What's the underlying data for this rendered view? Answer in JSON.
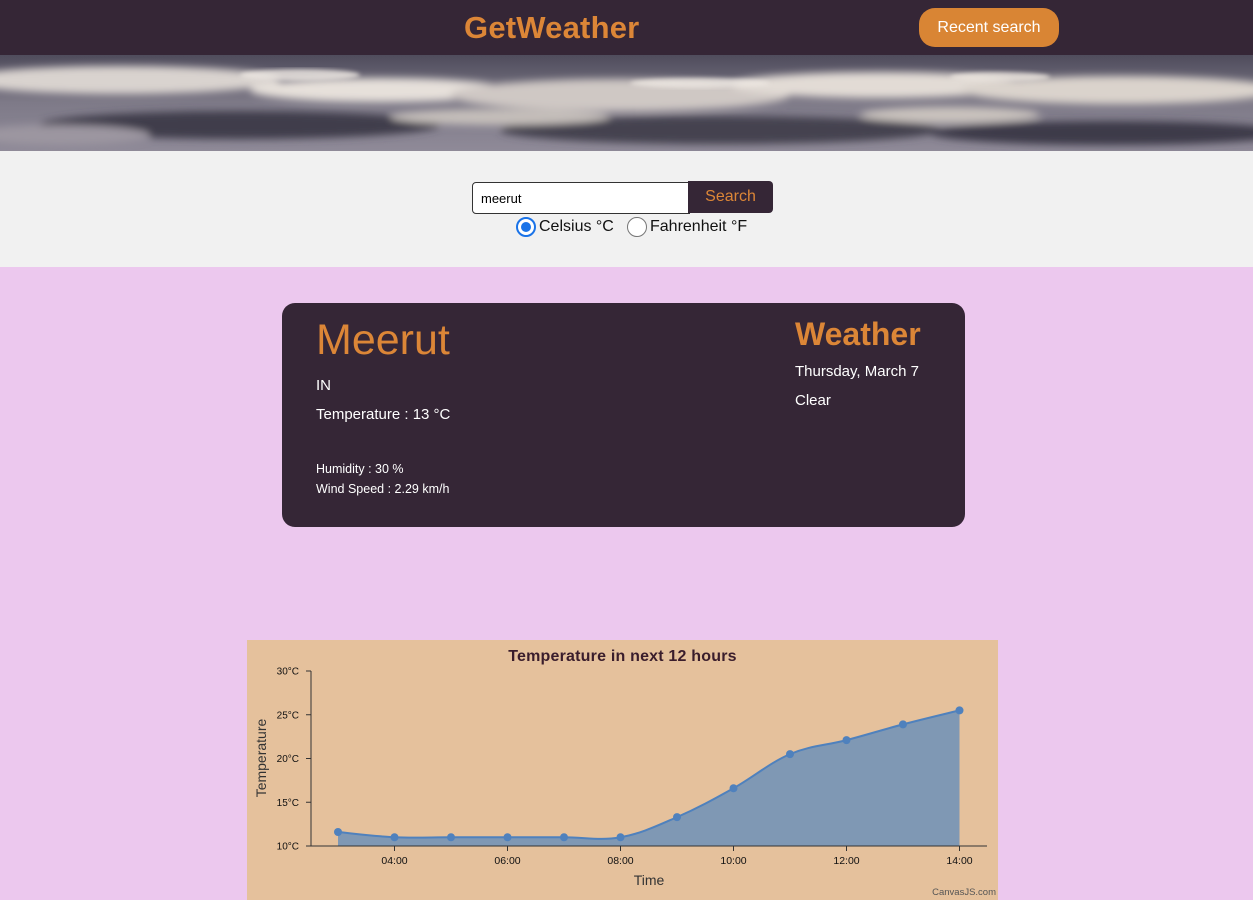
{
  "header": {
    "brand": "GetWeather",
    "recent_search_label": "Recent search"
  },
  "search": {
    "query": "meerut",
    "button_label": "Search",
    "units": [
      {
        "label": "Celsius °C",
        "checked": true
      },
      {
        "label": "Fahrenheit °F",
        "checked": false
      }
    ]
  },
  "weather_card": {
    "city": "Meerut",
    "country": "IN",
    "temperature": "Temperature : 13 °C",
    "humidity": "Humidity : 30 %",
    "wind_speed": "Wind Speed : 2.29 km/h",
    "title": "Weather",
    "date": "Thursday, March 7",
    "condition": "Clear"
  },
  "chart_credit": "CanvasJS.com",
  "colors": {
    "header_bg": "#352636",
    "accent": "#dc8637",
    "page_bg": "#ecc8ee",
    "chart_bg": "#e5c19c",
    "area_fill": "#7f98b4",
    "line": "#4f81bd"
  },
  "chart_data": {
    "type": "area",
    "title": "Temperature in next 12 hours",
    "xlabel": "Time",
    "ylabel": "Temperature",
    "x": [
      "03:00",
      "04:00",
      "05:00",
      "06:00",
      "07:00",
      "08:00",
      "09:00",
      "10:00",
      "11:00",
      "12:00",
      "13:00",
      "14:00"
    ],
    "series": [
      {
        "values": [
          11.6,
          11.0,
          11.0,
          11.0,
          11.0,
          11.0,
          13.3,
          16.6,
          20.5,
          22.1,
          23.9,
          25.5
        ]
      }
    ],
    "x_ticks": [
      "04:00",
      "06:00",
      "08:00",
      "10:00",
      "12:00",
      "14:00"
    ],
    "y_ticks": [
      "10°C",
      "15°C",
      "20°C",
      "25°C",
      "30°C"
    ],
    "ylim": [
      10,
      30
    ],
    "grid": false,
    "legend": "none"
  }
}
